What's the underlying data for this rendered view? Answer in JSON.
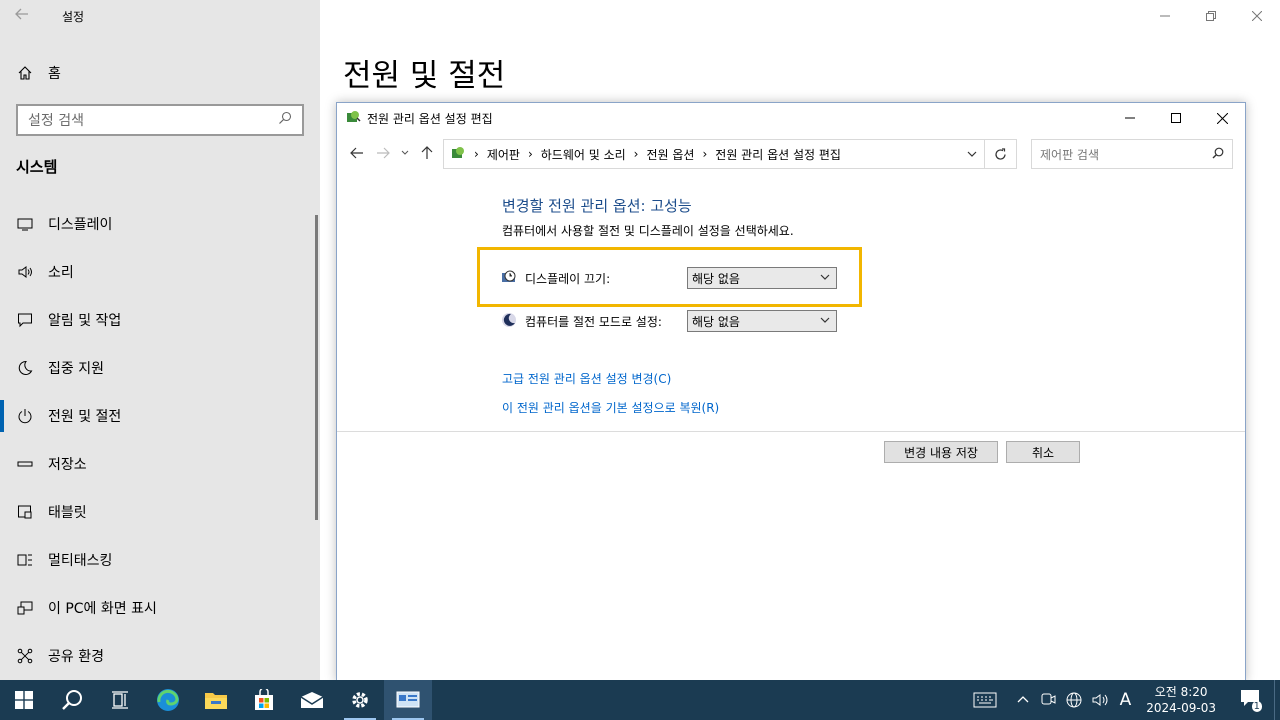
{
  "settings": {
    "app_title": "설정",
    "home_label": "홈",
    "search_placeholder": "설정 검색",
    "section_title": "시스템",
    "page_title": "전원 및 절전",
    "nav_items": [
      {
        "label": "디스플레이",
        "icon": "monitor-icon"
      },
      {
        "label": "소리",
        "icon": "speaker-icon"
      },
      {
        "label": "알림 및 작업",
        "icon": "notification-icon"
      },
      {
        "label": "집중 지원",
        "icon": "moon-icon"
      },
      {
        "label": "전원 및 절전",
        "icon": "power-icon",
        "selected": true
      },
      {
        "label": "저장소",
        "icon": "storage-icon"
      },
      {
        "label": "태블릿",
        "icon": "tablet-icon"
      },
      {
        "label": "멀티태스킹",
        "icon": "multitask-icon"
      },
      {
        "label": "이 PC에 화면 표시",
        "icon": "project-icon"
      },
      {
        "label": "공유 환경",
        "icon": "share-icon"
      }
    ]
  },
  "control_panel": {
    "title": "전원 관리 옵션 설정 편집",
    "breadcrumb": [
      "제어판",
      "하드웨어 및 소리",
      "전원 옵션",
      "전원 관리 옵션 설정 편집"
    ],
    "search_placeholder": "제어판 검색",
    "heading": "변경할 전원 관리 옵션: 고성능",
    "description": "컴퓨터에서 사용할 절전 및 디스플레이 설정을 선택하세요.",
    "display_off_label": "디스플레이 끄기:",
    "display_off_value": "해당 없음",
    "sleep_label": "컴퓨터를 절전 모드로 설정:",
    "sleep_value": "해당 없음",
    "advanced_link": "고급 전원 관리 옵션 설정 변경(C)",
    "restore_link": "이 전원 관리 옵션을 기본 설정으로 복원(R)",
    "save_button": "변경 내용 저장",
    "cancel_button": "취소"
  },
  "taskbar": {
    "clock_time": "오전 8:20",
    "clock_date": "2024-09-03",
    "ime_label": "A",
    "notification_count": "1"
  },
  "colors": {
    "accent": "#0063b1",
    "highlight": "#f2b600",
    "link": "#0066cc",
    "taskbar": "#1b3b52"
  }
}
